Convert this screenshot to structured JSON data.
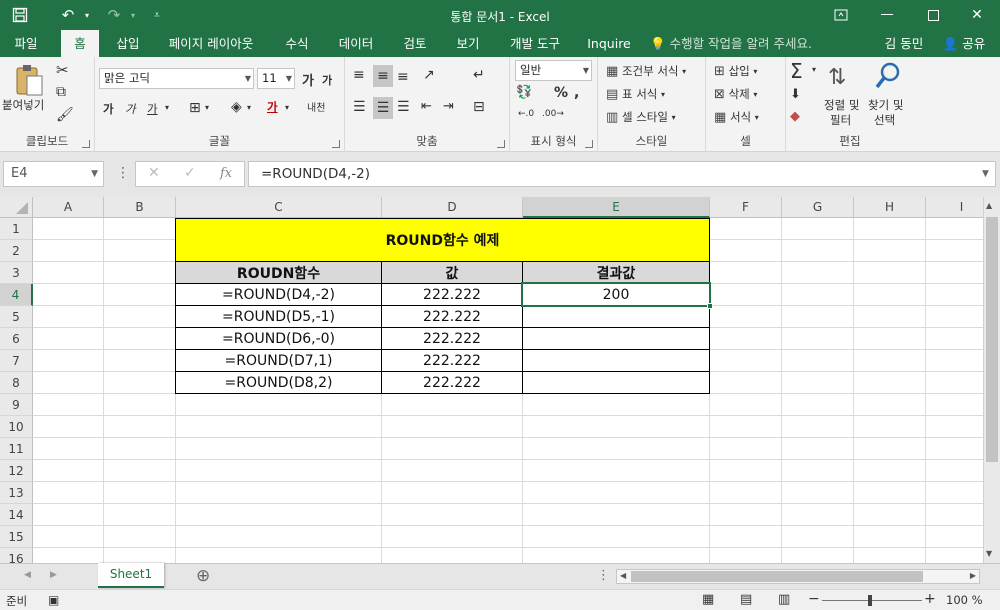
{
  "window": {
    "title": "통합 문서1 - Excel"
  },
  "tabs": [
    "파일",
    "홈",
    "삽입",
    "페이지 레이아웃",
    "수식",
    "데이터",
    "검토",
    "보기",
    "개발 도구",
    "Inquire"
  ],
  "tell_me": "수행할 작업을 알려 주세요.",
  "user": "김 동민",
  "share": "공유",
  "ribbon": {
    "clipboard": {
      "paste": "붙여넣기",
      "label": "클립보드"
    },
    "font": {
      "name": "맑은 고딕",
      "size": "11",
      "grow": "가",
      "shrink": "가",
      "bold": "가",
      "italic": "가",
      "underline": "가",
      "font_color": "가",
      "phonetic": "내천",
      "label": "글꼴"
    },
    "align": {
      "label": "맞춤"
    },
    "number": {
      "format": "일반",
      "label": "표시 형식"
    },
    "styles": {
      "conditional": "조건부 서식",
      "table": "표 서식",
      "cell": "셀 스타일",
      "label": "스타일"
    },
    "cells": {
      "insert": "삽입",
      "delete": "삭제",
      "format": "서식",
      "label": "셀"
    },
    "editing": {
      "sort_line1": "정렬 및",
      "sort_line2": "필터",
      "find_line1": "찾기 및",
      "find_line2": "선택",
      "label": "편집"
    }
  },
  "formula_bar": {
    "name_box": "E4",
    "formula": "=ROUND(D4,-2)",
    "fx": "fx"
  },
  "grid": {
    "columns": [
      "A",
      "B",
      "C",
      "D",
      "E",
      "F",
      "G",
      "H",
      "I"
    ],
    "rows": [
      "1",
      "2",
      "3",
      "4",
      "5",
      "6",
      "7",
      "8",
      "9",
      "10",
      "11",
      "12",
      "13",
      "14",
      "15",
      "16"
    ],
    "selected_col": "E",
    "selected_row": "4",
    "title": "ROUND함수 예제",
    "headers": [
      "ROUDN함수",
      "값",
      "결과값"
    ],
    "data": [
      [
        "=ROUND(D4,-2)",
        "222.222",
        "200"
      ],
      [
        "=ROUND(D5,-1)",
        "222.222",
        ""
      ],
      [
        "=ROUND(D6,-0)",
        "222.222",
        ""
      ],
      [
        "=ROUND(D7,1)",
        "222.222",
        ""
      ],
      [
        "=ROUND(D8,2)",
        "222.222",
        ""
      ]
    ]
  },
  "sheet_tab": "Sheet1",
  "status": {
    "ready": "준비",
    "zoom": "100 %"
  },
  "colors": {
    "brand": "#217346",
    "title_fill": "#ffff00",
    "header_fill": "#d9d9d9"
  }
}
